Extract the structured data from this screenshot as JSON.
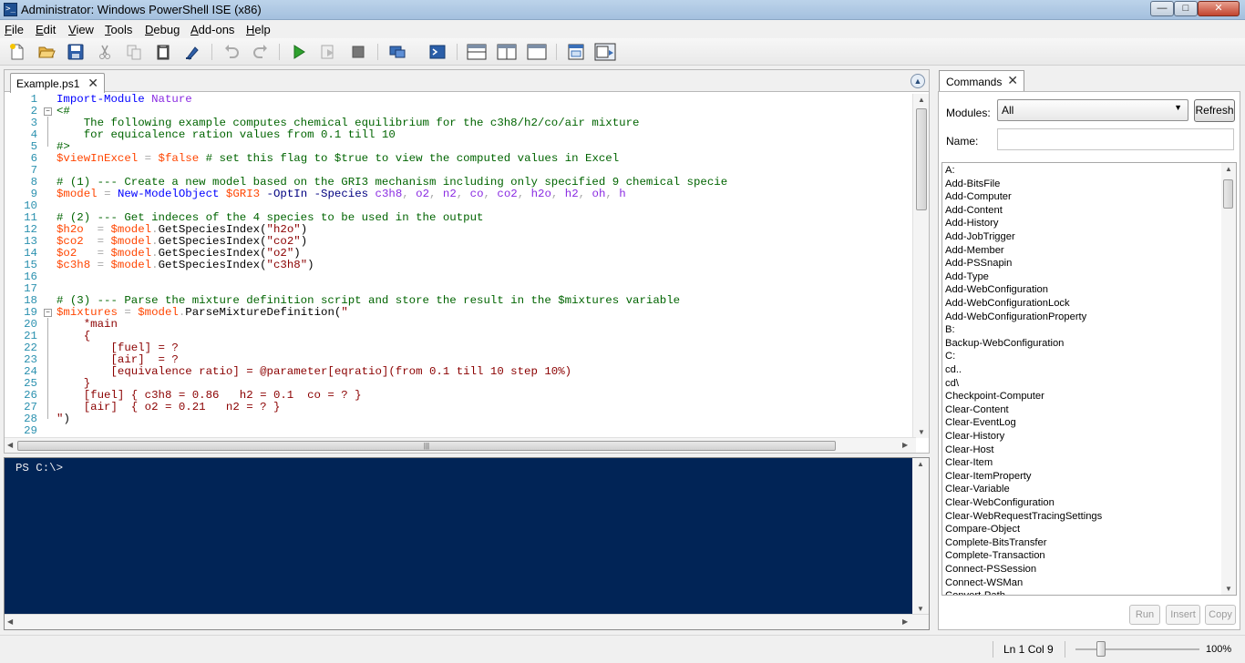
{
  "window": {
    "title": "Administrator: Windows PowerShell ISE (x86)",
    "min": "—",
    "max": "□",
    "close": "✕"
  },
  "menu": {
    "items": [
      {
        "key": "F",
        "rest": "ile"
      },
      {
        "key": "E",
        "rest": "dit"
      },
      {
        "key": "V",
        "rest": "iew"
      },
      {
        "key": "T",
        "rest": "ools"
      },
      {
        "key": "D",
        "rest": "ebug"
      },
      {
        "key": "A",
        "rest": "dd-ons"
      },
      {
        "key": "H",
        "rest": "elp"
      }
    ]
  },
  "toolbar": {
    "icons": [
      "new-icon",
      "open-icon",
      "save-icon",
      "cut-icon",
      "copy-icon",
      "paste-icon",
      "clear-console-icon",
      "undo-icon",
      "redo-icon",
      "run-script-icon",
      "run-selection-icon",
      "stop-icon",
      "new-remote-tab-icon",
      "start-powershell-icon",
      "show-script-pane-top-icon",
      "show-script-pane-right-icon",
      "show-script-pane-max-icon",
      "show-command-window-icon",
      "show-command-addon-icon"
    ]
  },
  "editor": {
    "tab_label": "Example.ps1",
    "lines": [
      {
        "n": "1",
        "fold": "",
        "tokens": [
          [
            "k-cmd",
            "Import-Module"
          ],
          [
            "k-def",
            " "
          ],
          [
            "k-arg",
            "Nature"
          ]
        ]
      },
      {
        "n": "2",
        "fold": "⊟",
        "tokens": [
          [
            "k-com",
            "<#"
          ]
        ]
      },
      {
        "n": "3",
        "fold": "",
        "tokens": [
          [
            "k-com",
            "    The following example computes chemical equilibrium for the c3h8/h2/co/air mixture"
          ]
        ]
      },
      {
        "n": "4",
        "fold": "",
        "tokens": [
          [
            "k-com",
            "    for equicalence ration values from 0.1 till 10"
          ]
        ]
      },
      {
        "n": "5",
        "fold": "",
        "tokens": [
          [
            "k-com",
            "#>"
          ]
        ]
      },
      {
        "n": "6",
        "fold": "",
        "tokens": [
          [
            "k-var",
            "$viewInExcel"
          ],
          [
            "k-def",
            " "
          ],
          [
            "k-op",
            "="
          ],
          [
            "k-def",
            " "
          ],
          [
            "k-var",
            "$false"
          ],
          [
            "k-def",
            " "
          ],
          [
            "k-com",
            "# set this flag to $true to view the computed values in Excel"
          ]
        ]
      },
      {
        "n": "7",
        "fold": "",
        "tokens": []
      },
      {
        "n": "8",
        "fold": "",
        "tokens": [
          [
            "k-com",
            "# (1) --- Create a new model based on the GRI3 mechanism including only specified 9 chemical specie"
          ]
        ]
      },
      {
        "n": "9",
        "fold": "",
        "tokens": [
          [
            "k-var",
            "$model"
          ],
          [
            "k-def",
            " "
          ],
          [
            "k-op",
            "="
          ],
          [
            "k-def",
            " "
          ],
          [
            "k-cmd",
            "New-ModelObject"
          ],
          [
            "k-def",
            " "
          ],
          [
            "k-var",
            "$GRI3"
          ],
          [
            "k-def",
            " "
          ],
          [
            "k-prm",
            "-OptIn"
          ],
          [
            "k-def",
            " "
          ],
          [
            "k-prm",
            "-Species"
          ],
          [
            "k-def",
            " "
          ],
          [
            "k-arg",
            "c3h8"
          ],
          [
            "k-op",
            ","
          ],
          [
            "k-def",
            " "
          ],
          [
            "k-arg",
            "o2"
          ],
          [
            "k-op",
            ","
          ],
          [
            "k-def",
            " "
          ],
          [
            "k-arg",
            "n2"
          ],
          [
            "k-op",
            ","
          ],
          [
            "k-def",
            " "
          ],
          [
            "k-arg",
            "co"
          ],
          [
            "k-op",
            ","
          ],
          [
            "k-def",
            " "
          ],
          [
            "k-arg",
            "co2"
          ],
          [
            "k-op",
            ","
          ],
          [
            "k-def",
            " "
          ],
          [
            "k-arg",
            "h2o"
          ],
          [
            "k-op",
            ","
          ],
          [
            "k-def",
            " "
          ],
          [
            "k-arg",
            "h2"
          ],
          [
            "k-op",
            ","
          ],
          [
            "k-def",
            " "
          ],
          [
            "k-arg",
            "oh"
          ],
          [
            "k-op",
            ","
          ],
          [
            "k-def",
            " "
          ],
          [
            "k-arg",
            "h"
          ]
        ]
      },
      {
        "n": "10",
        "fold": "",
        "tokens": []
      },
      {
        "n": "11",
        "fold": "",
        "tokens": [
          [
            "k-com",
            "# (2) --- Get indeces of the 4 species to be used in the output"
          ]
        ]
      },
      {
        "n": "12",
        "fold": "",
        "tokens": [
          [
            "k-var",
            "$h2o"
          ],
          [
            "k-def",
            "  "
          ],
          [
            "k-op",
            "="
          ],
          [
            "k-def",
            " "
          ],
          [
            "k-var",
            "$model"
          ],
          [
            "k-op",
            "."
          ],
          [
            "k-def",
            "GetSpeciesIndex("
          ],
          [
            "k-str",
            "\"h2o\""
          ],
          [
            "k-def",
            ")"
          ]
        ]
      },
      {
        "n": "13",
        "fold": "",
        "tokens": [
          [
            "k-var",
            "$co2"
          ],
          [
            "k-def",
            "  "
          ],
          [
            "k-op",
            "="
          ],
          [
            "k-def",
            " "
          ],
          [
            "k-var",
            "$model"
          ],
          [
            "k-op",
            "."
          ],
          [
            "k-def",
            "GetSpeciesIndex("
          ],
          [
            "k-str",
            "\"co2\""
          ],
          [
            "k-def",
            ")"
          ]
        ]
      },
      {
        "n": "14",
        "fold": "",
        "tokens": [
          [
            "k-var",
            "$o2"
          ],
          [
            "k-def",
            "   "
          ],
          [
            "k-op",
            "="
          ],
          [
            "k-def",
            " "
          ],
          [
            "k-var",
            "$model"
          ],
          [
            "k-op",
            "."
          ],
          [
            "k-def",
            "GetSpeciesIndex("
          ],
          [
            "k-str",
            "\"o2\""
          ],
          [
            "k-def",
            ")"
          ]
        ]
      },
      {
        "n": "15",
        "fold": "",
        "tokens": [
          [
            "k-var",
            "$c3h8"
          ],
          [
            "k-def",
            " "
          ],
          [
            "k-op",
            "="
          ],
          [
            "k-def",
            " "
          ],
          [
            "k-var",
            "$model"
          ],
          [
            "k-op",
            "."
          ],
          [
            "k-def",
            "GetSpeciesIndex("
          ],
          [
            "k-str",
            "\"c3h8\""
          ],
          [
            "k-def",
            ")"
          ]
        ]
      },
      {
        "n": "16",
        "fold": "",
        "tokens": []
      },
      {
        "n": "17",
        "fold": "",
        "tokens": []
      },
      {
        "n": "18",
        "fold": "",
        "tokens": [
          [
            "k-com",
            "# (3) --- Parse the mixture definition script and store the result in the $mixtures variable"
          ]
        ]
      },
      {
        "n": "19",
        "fold": "⊟",
        "tokens": [
          [
            "k-var",
            "$mixtures"
          ],
          [
            "k-def",
            " "
          ],
          [
            "k-op",
            "="
          ],
          [
            "k-def",
            " "
          ],
          [
            "k-var",
            "$model"
          ],
          [
            "k-op",
            "."
          ],
          [
            "k-def",
            "ParseMixtureDefinition("
          ],
          [
            "k-str",
            "\""
          ]
        ]
      },
      {
        "n": "20",
        "fold": "",
        "tokens": [
          [
            "k-str",
            "    *main"
          ]
        ]
      },
      {
        "n": "21",
        "fold": "",
        "tokens": [
          [
            "k-str",
            "    {"
          ]
        ]
      },
      {
        "n": "22",
        "fold": "",
        "tokens": [
          [
            "k-str",
            "        [fuel] = ?"
          ]
        ]
      },
      {
        "n": "23",
        "fold": "",
        "tokens": [
          [
            "k-str",
            "        [air]  = ?"
          ]
        ]
      },
      {
        "n": "24",
        "fold": "",
        "tokens": [
          [
            "k-str",
            "        [equivalence ratio] = @parameter[eqratio](from 0.1 till 10 step 10%)"
          ]
        ]
      },
      {
        "n": "25",
        "fold": "",
        "tokens": [
          [
            "k-str",
            "    }"
          ]
        ]
      },
      {
        "n": "26",
        "fold": "",
        "tokens": [
          [
            "k-str",
            "    [fuel] { c3h8 = 0.86   h2 = 0.1  co = ? }"
          ]
        ]
      },
      {
        "n": "27",
        "fold": "",
        "tokens": [
          [
            "k-str",
            "    [air]  { o2 = 0.21   n2 = ? }"
          ]
        ]
      },
      {
        "n": "28",
        "fold": "",
        "tokens": [
          [
            "k-str",
            "\""
          ],
          [
            "k-def",
            ")"
          ]
        ]
      },
      {
        "n": "29",
        "fold": "",
        "tokens": []
      }
    ]
  },
  "console": {
    "prompt": "PS C:\\>"
  },
  "commands": {
    "tab_label": "Commands",
    "modules_label": "Modules:",
    "modules_value": "All",
    "refresh_label": "Refresh",
    "name_label": "Name:",
    "name_value": "",
    "list": [
      "A:",
      "Add-BitsFile",
      "Add-Computer",
      "Add-Content",
      "Add-History",
      "Add-JobTrigger",
      "Add-Member",
      "Add-PSSnapin",
      "Add-Type",
      "Add-WebConfiguration",
      "Add-WebConfigurationLock",
      "Add-WebConfigurationProperty",
      "B:",
      "Backup-WebConfiguration",
      "C:",
      "cd..",
      "cd\\",
      "Checkpoint-Computer",
      "Clear-Content",
      "Clear-EventLog",
      "Clear-History",
      "Clear-Host",
      "Clear-Item",
      "Clear-ItemProperty",
      "Clear-Variable",
      "Clear-WebConfiguration",
      "Clear-WebRequestTracingSettings",
      "Compare-Object",
      "Complete-BitsTransfer",
      "Complete-Transaction",
      "Connect-PSSession",
      "Connect-WSMan",
      "Convert-Path"
    ],
    "run_label": "Run",
    "insert_label": "Insert",
    "copy_label": "Copy"
  },
  "status": {
    "position": "Ln 1  Col 9",
    "zoom": "100%"
  }
}
